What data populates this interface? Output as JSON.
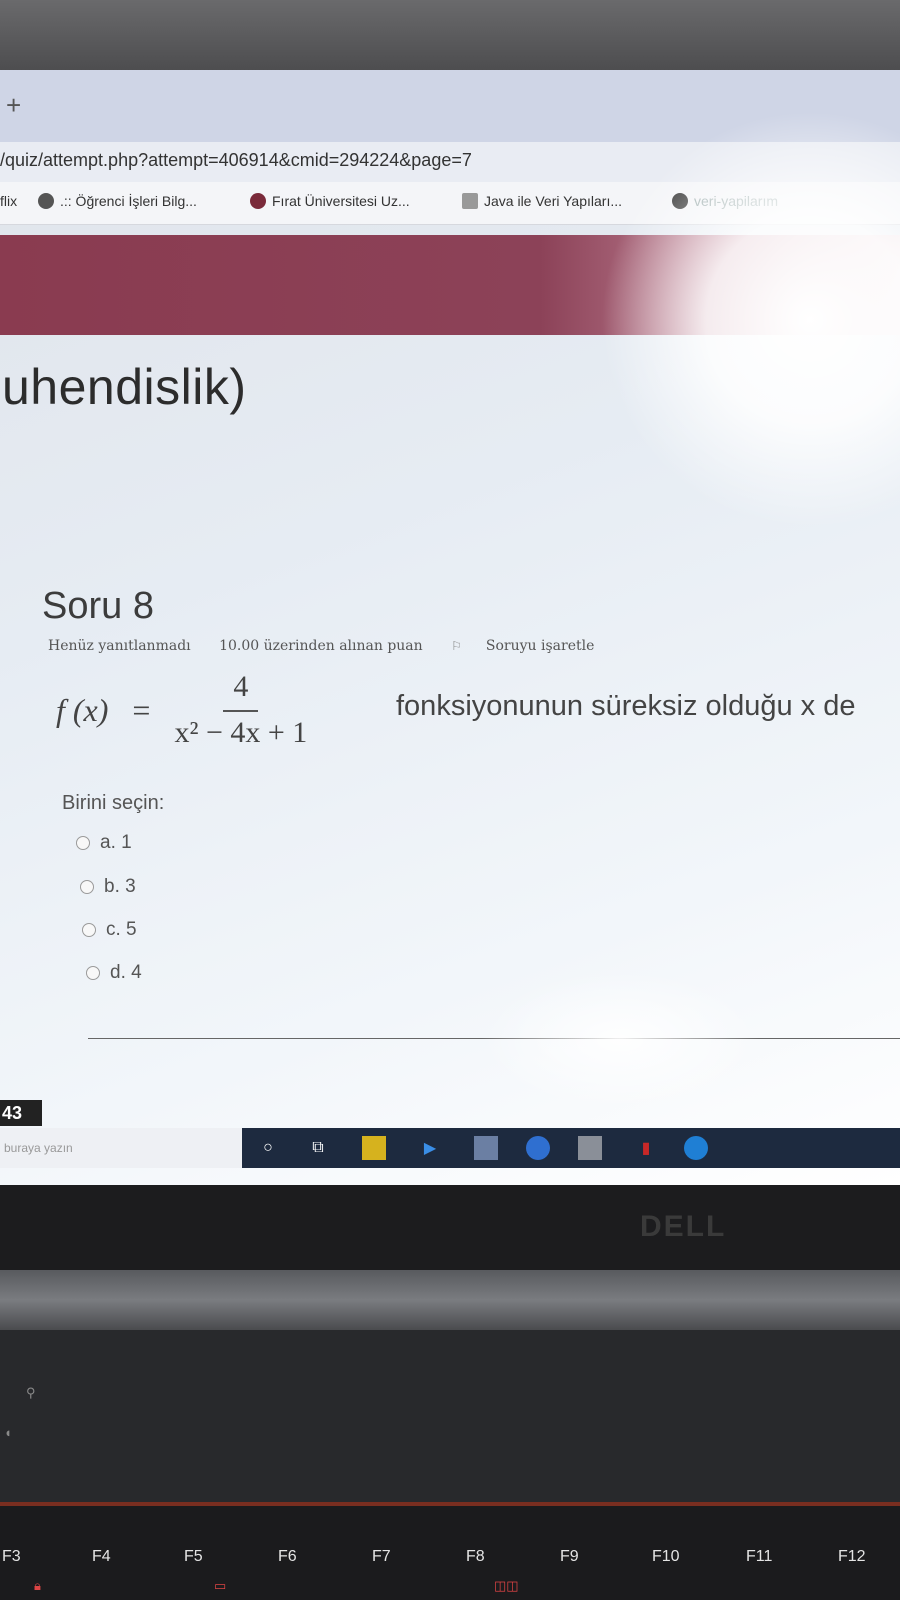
{
  "browser": {
    "new_tab_label": "+",
    "url": "/quiz/attempt.php?attempt=406914&cmid=294224&page=7",
    "bookmarks": [
      {
        "label": "flix",
        "icon": "netflix-icon"
      },
      {
        "label": ".:: Öğrenci İşleri Bilg...",
        "icon": "globe-icon"
      },
      {
        "label": "Fırat Üniversitesi Uz...",
        "icon": "university-icon"
      },
      {
        "label": "Java ile Veri Yapıları...",
        "icon": "document-icon"
      },
      {
        "label": "veri-yapilarım",
        "icon": "github-icon"
      }
    ]
  },
  "page": {
    "course_title": "uhendislik)",
    "colors": {
      "banner": "#8a3b50",
      "text": "#444444"
    }
  },
  "question": {
    "title": "Soru 8",
    "status": "Henüz yanıtlanmadı",
    "points": "10.00 üzerinden alınan puan",
    "flag_label": "Soruyu işaretle",
    "formula": {
      "lhs": "f (x)",
      "equals": "=",
      "numerator": "4",
      "denominator": "x² − 4x + 1"
    },
    "text": "fonksiyonunun süreksiz olduğu x de",
    "choose_label": "Birini seçin:",
    "options": [
      {
        "label": "a. 1"
      },
      {
        "label": "b. 3"
      },
      {
        "label": "c. 5"
      },
      {
        "label": "d. 4"
      }
    ]
  },
  "taskbar": {
    "clock_badge": "43",
    "search_placeholder": "buraya yazın"
  },
  "laptop": {
    "brand": "DELL",
    "fkeys": [
      "F3",
      "F4",
      "F5",
      "F6",
      "F7",
      "F8",
      "F9",
      "F10",
      "F11",
      "F12"
    ]
  }
}
